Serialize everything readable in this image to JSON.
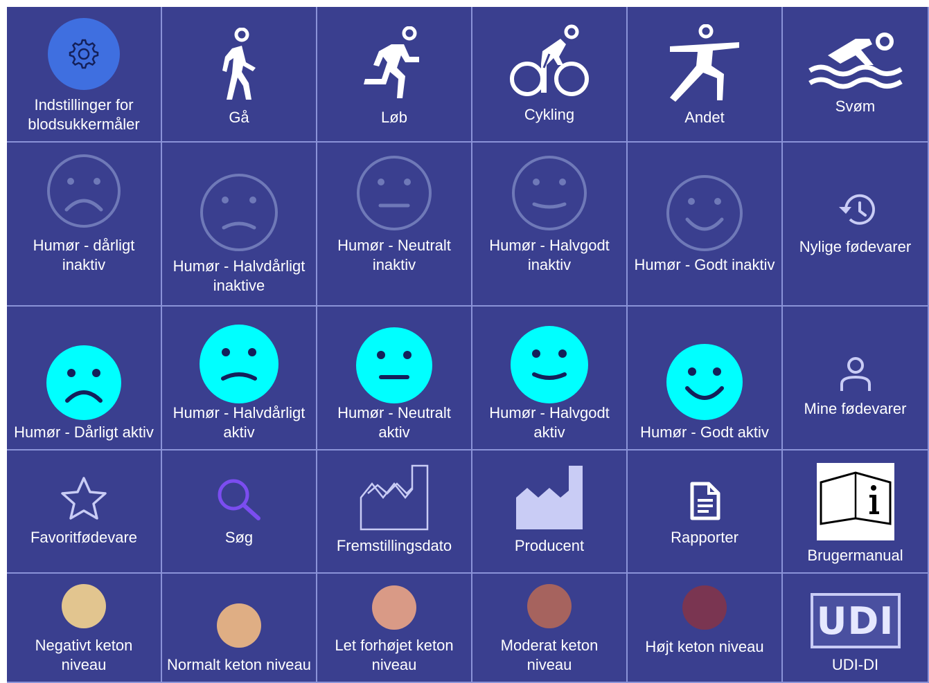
{
  "colors": {
    "background": "#3a3f8f",
    "grid_line": "#8b93d8",
    "settings_circle": "#3f6fe0",
    "face_active": "#00ffff",
    "face_inactive_outline": "#6f79b8",
    "factory_fill": "#c9ccf5",
    "search": "#7b4df0"
  },
  "row1": {
    "settings": "Indstillinger for blodsukkermåler",
    "walk": "Gå",
    "run": "Løb",
    "cycling": "Cykling",
    "other": "Andet",
    "swim": "Svøm"
  },
  "row2": {
    "mood_bad": "Humør - dårligt inaktiv",
    "mood_halfbad": "Humør - Halvdårligt inaktive",
    "mood_neutral": "Humør - Neutralt inaktiv",
    "mood_halfgood": "Humør - Halvgodt inaktiv",
    "mood_good": "Humør - Godt inaktiv",
    "recent_foods": "Nylige fødevarer"
  },
  "row3": {
    "mood_bad": "Humør - Dårligt aktiv",
    "mood_halfbad": "Humør - Halvdårligt aktiv",
    "mood_neutral": "Humør - Neutralt aktiv",
    "mood_halfgood": "Humør - Halvgodt aktiv",
    "mood_good": "Humør - Godt aktiv",
    "my_foods": "Mine fødevarer"
  },
  "row4": {
    "favorite_food": "Favoritfødevare",
    "search": "Søg",
    "manufacture_date": "Fremstillingsdato",
    "manufacturer": "Producent",
    "reports": "Rapporter",
    "user_manual": "Brugermanual"
  },
  "row5": {
    "ketone_negative": "Negativt keton niveau",
    "ketone_normal": "Normalt keton niveau",
    "ketone_slightly_high": "Let forhøjet keton niveau",
    "ketone_moderate": "Moderat keton niveau",
    "ketone_high": "Højt keton niveau",
    "udi_logo_text": "UDI",
    "udi_di": "UDI-DI",
    "ketone_colors": [
      "#e2c58f",
      "#dfae84",
      "#d99a86",
      "#a6635e",
      "#7a3551"
    ]
  }
}
